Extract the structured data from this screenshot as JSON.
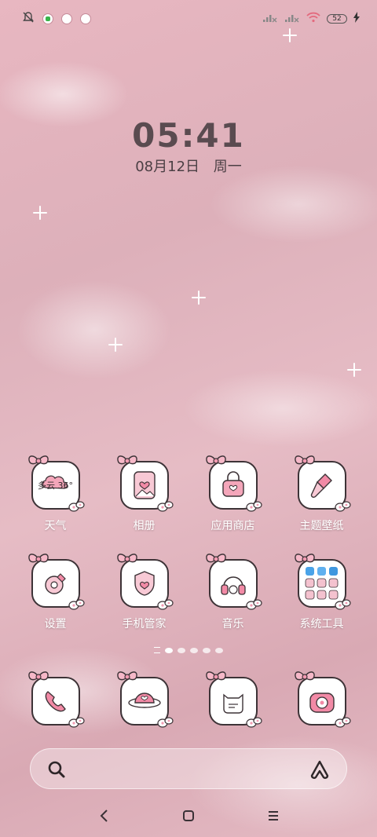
{
  "status_bar": {
    "battery_level": "52",
    "icons_left": [
      "bell-muted-icon",
      "green-app-icon",
      "pink-app-icon-1",
      "pink-app-icon-2"
    ],
    "icons_right": [
      "signal-1-icon",
      "signal-2-icon",
      "wifi-icon",
      "battery-icon",
      "charging-icon"
    ]
  },
  "lock": {
    "time": "05:41",
    "date": "08月12日",
    "weekday": "周一"
  },
  "row1": [
    {
      "label": "天气",
      "icon": "weather-icon",
      "overlay": "多云 36°"
    },
    {
      "label": "相册",
      "icon": "gallery-icon"
    },
    {
      "label": "应用商店",
      "icon": "app-store-icon"
    },
    {
      "label": "主题壁纸",
      "icon": "themes-icon"
    }
  ],
  "row2": [
    {
      "label": "设置",
      "icon": "settings-icon"
    },
    {
      "label": "手机管家",
      "icon": "security-icon"
    },
    {
      "label": "音乐",
      "icon": "music-icon"
    },
    {
      "label": "系统工具",
      "icon": "system-tools-folder-icon"
    }
  ],
  "dock": [
    {
      "icon": "phone-icon"
    },
    {
      "icon": "messages-icon"
    },
    {
      "icon": "contacts-icon"
    },
    {
      "icon": "camera-icon"
    }
  ],
  "colors": {
    "icon_pink": "#f2a3b8",
    "outline": "#3d3337",
    "wallpaper": "#e2b4bf"
  }
}
